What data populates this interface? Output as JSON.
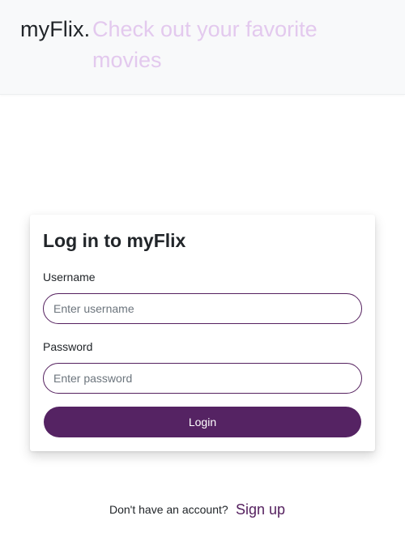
{
  "navbar": {
    "brand": "myFlix.",
    "tagline": "Check out your favorite movies"
  },
  "login_card": {
    "title": "Log in to myFlix",
    "username_label": "Username",
    "username_placeholder": "Enter username",
    "username_value": "",
    "password_label": "Password",
    "password_placeholder": "Enter password",
    "password_value": "",
    "login_button": "Login"
  },
  "signup": {
    "prompt": "Don't have an account?",
    "link": "Sign up"
  },
  "colors": {
    "accent": "#55215f",
    "tagline": "#e3c9ee",
    "navbar_bg": "#f8f9fa"
  }
}
